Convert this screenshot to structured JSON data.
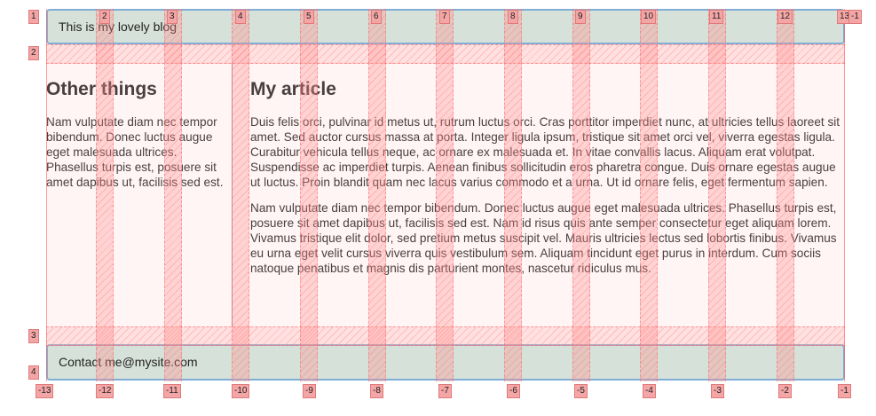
{
  "header": {
    "text": "This is my lovely blog"
  },
  "sidebar": {
    "title": "Other things",
    "text": "Nam vulputate diam nec tempor bibendum. Donec luctus augue eget malesuada ultrices. Phasellus turpis est, posuere sit amet dapibus ut, facilisis sed est."
  },
  "article": {
    "title": "My article",
    "p1": "Duis felis orci, pulvinar id metus ut, rutrum luctus orci. Cras porttitor imperdiet nunc, at ultricies tellus laoreet sit amet. Sed auctor cursus massa at porta. Integer ligula ipsum, tristique sit amet orci vel, viverra egestas ligula. Curabitur vehicula tellus neque, ac ornare ex malesuada et. In vitae convallis lacus. Aliquam erat volutpat. Suspendisse ac imperdiet turpis. Aenean finibus sollicitudin eros pharetra congue. Duis ornare egestas augue ut luctus. Proin blandit quam nec lacus varius commodo et a urna. Ut id ornare felis, eget fermentum sapien.",
    "p2": "Nam vulputate diam nec tempor bibendum. Donec luctus augue eget malesuada ultrices. Phasellus turpis est, posuere sit amet dapibus ut, facilisis sed est. Nam id risus quis ante semper consectetur eget aliquam lorem. Vivamus tristique elit dolor, sed pretium metus suscipit vel. Mauris ultricies lectus sed lobortis finibus. Vivamus eu urna eget velit cursus viverra quis vestibulum sem. Aliquam tincidunt eget purus in interdum. Cum sociis natoque penatibus et magnis dis parturient montes, nascetur ridiculus mus."
  },
  "footer": {
    "text": "Contact me@mysite.com"
  },
  "grid_overlay": {
    "top_column_labels": [
      "1",
      "2",
      "3",
      "4",
      "5",
      "6",
      "7",
      "8",
      "9",
      "10",
      "11",
      "12",
      "13"
    ],
    "top_right_label": "-1",
    "row_labels": [
      "1",
      "2",
      "3",
      "4"
    ],
    "bottom_column_labels": [
      "-13",
      "-12",
      "-11",
      "-10",
      "-9",
      "-8",
      "-7",
      "-6",
      "-5",
      "-4",
      "-3",
      "-2",
      "-1"
    ],
    "colors": {
      "gap": "#f4a6a6",
      "box": "#d6e2d9",
      "box_border": "#80aed6"
    }
  }
}
